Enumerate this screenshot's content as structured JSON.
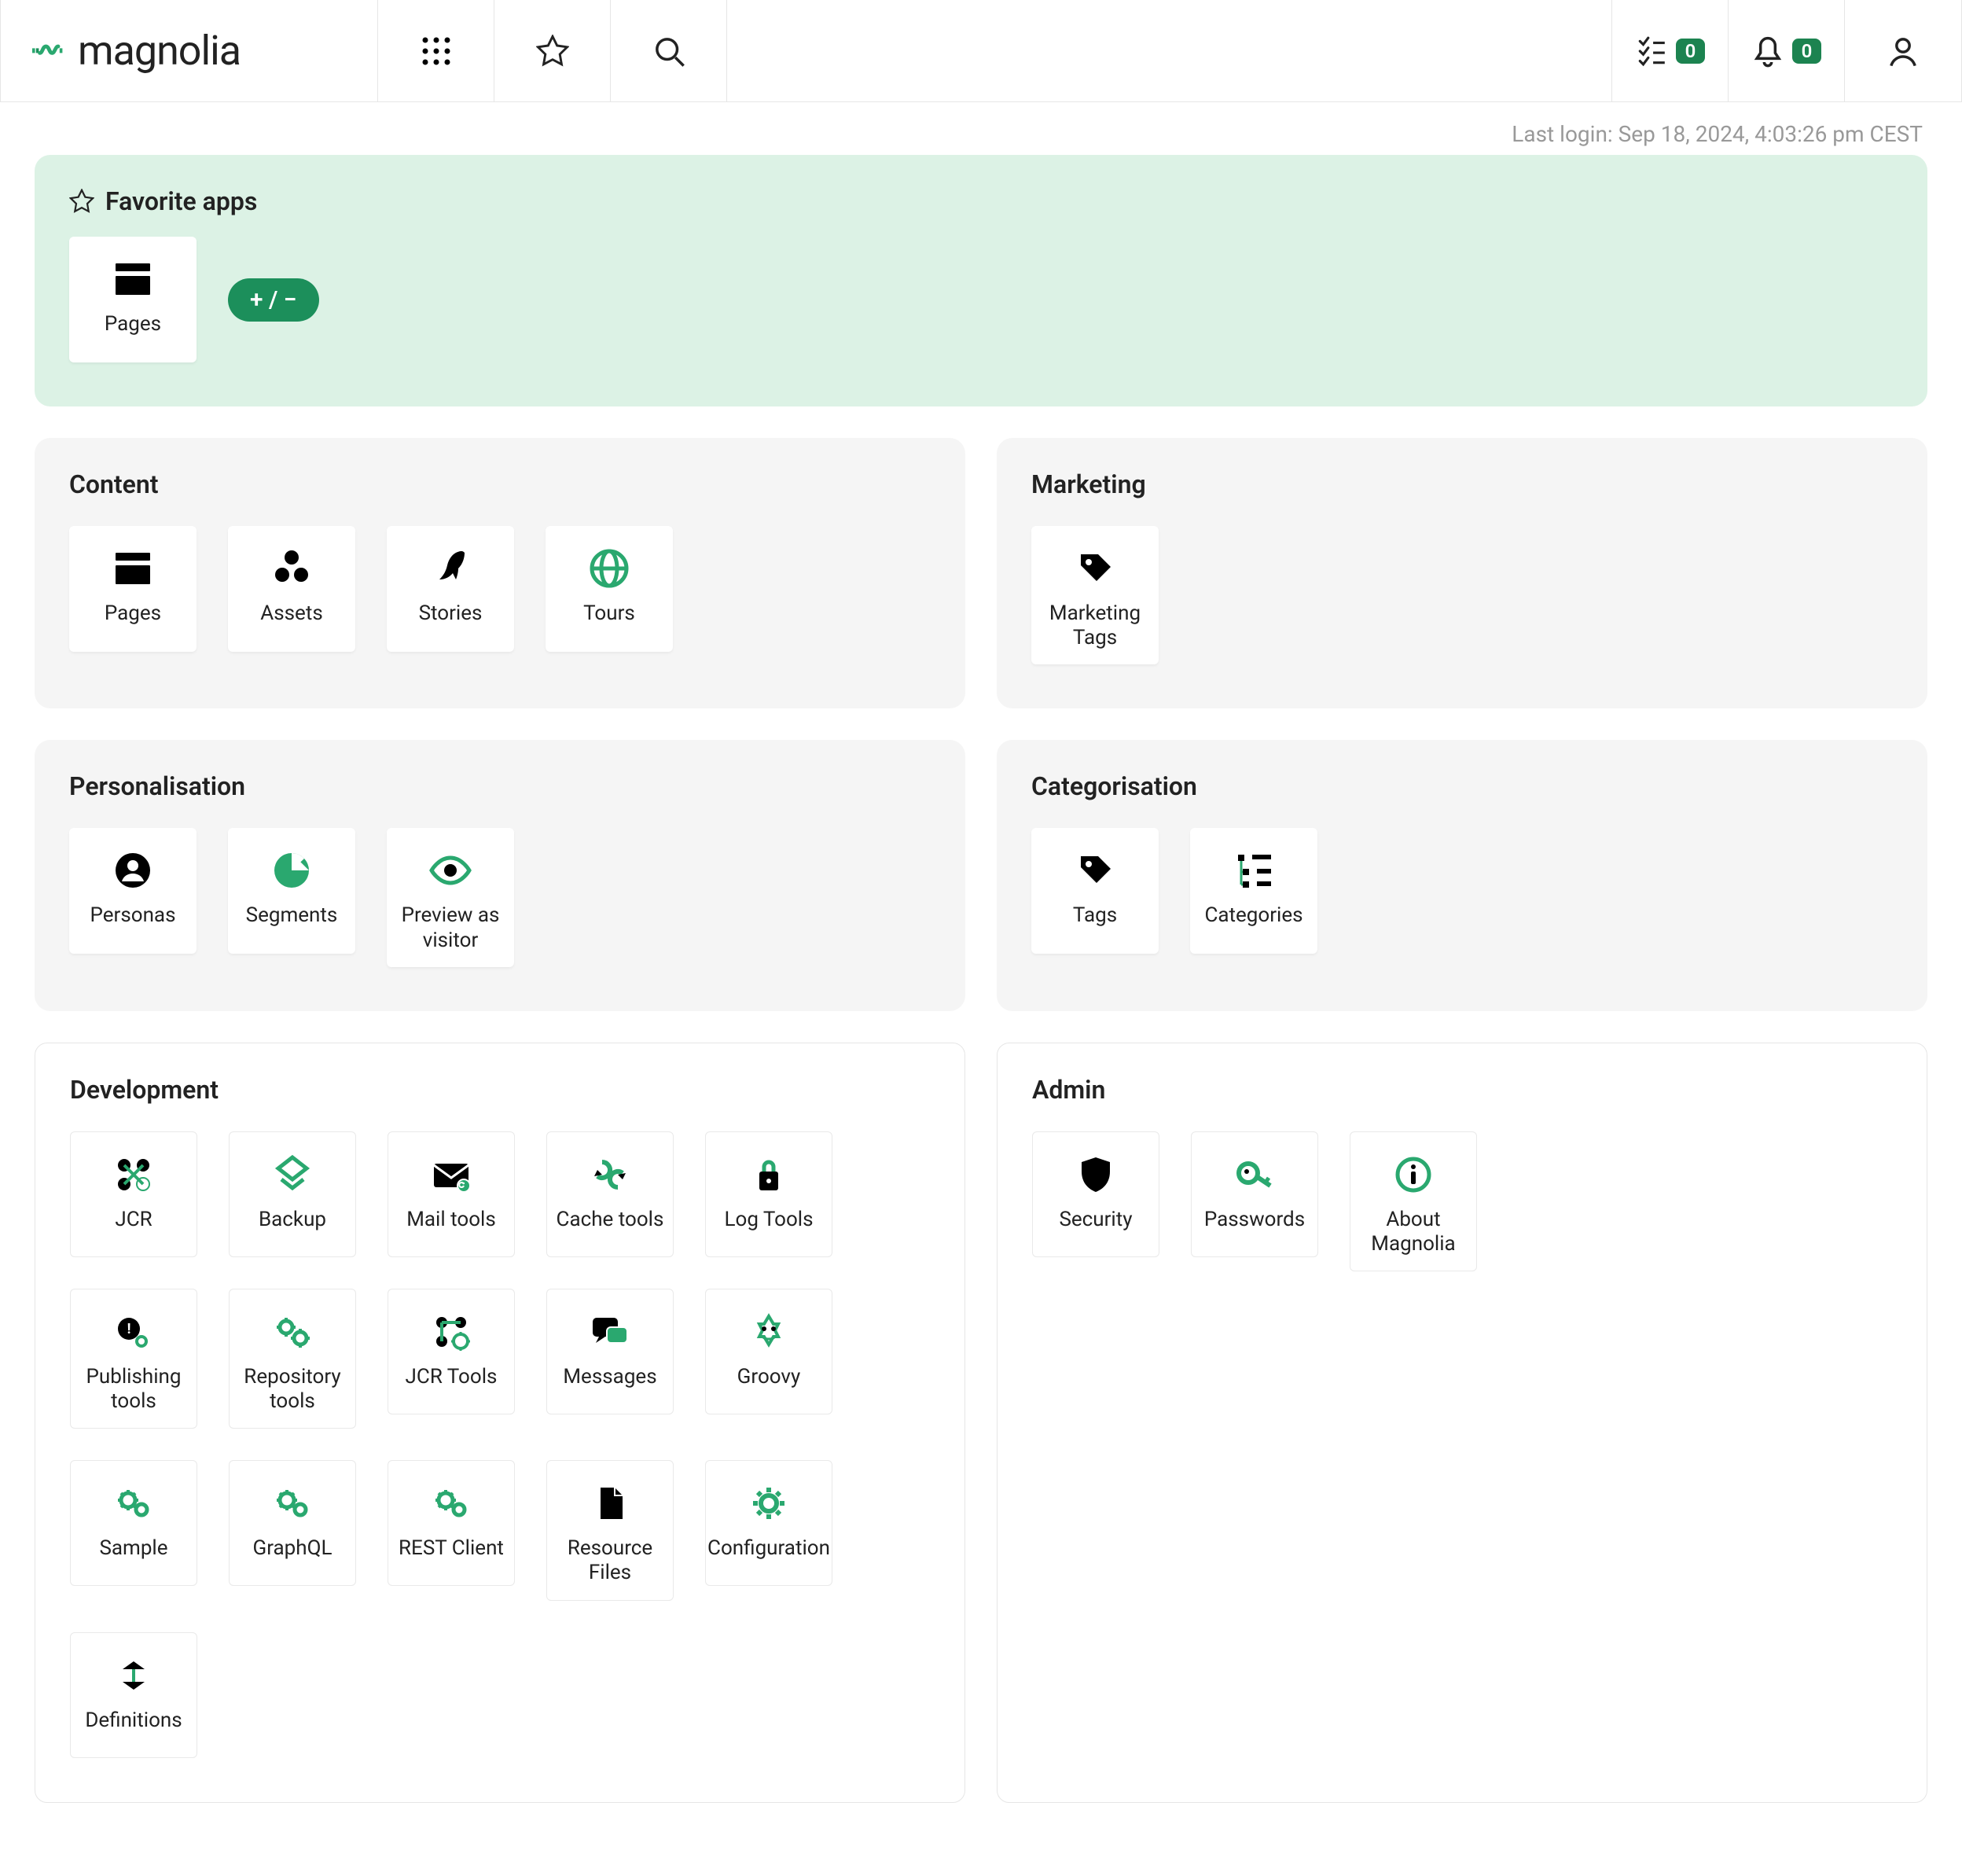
{
  "header": {
    "logo_text": "magnolia",
    "tasks_badge": "0",
    "notifications_badge": "0"
  },
  "last_login": "Last login: Sep 18, 2024, 4:03:26 pm CEST",
  "favorites": {
    "title": "Favorite apps",
    "edit_label": "+ / −",
    "items": [
      {
        "label": "Pages",
        "icon": "pages"
      }
    ]
  },
  "sections_grey": [
    {
      "title": "Content",
      "items": [
        {
          "label": "Pages",
          "icon": "pages"
        },
        {
          "label": "Assets",
          "icon": "assets"
        },
        {
          "label": "Stories",
          "icon": "stories"
        },
        {
          "label": "Tours",
          "icon": "tours"
        }
      ]
    },
    {
      "title": "Marketing",
      "items": [
        {
          "label": "Marketing Tags",
          "icon": "tag"
        }
      ]
    },
    {
      "title": "Personalisation",
      "items": [
        {
          "label": "Personas",
          "icon": "persona"
        },
        {
          "label": "Segments",
          "icon": "segments"
        },
        {
          "label": "Preview as visitor",
          "icon": "eye"
        }
      ]
    },
    {
      "title": "Categorisation",
      "items": [
        {
          "label": "Tags",
          "icon": "tag"
        },
        {
          "label": "Categories",
          "icon": "categories"
        }
      ]
    }
  ],
  "sections_bordered": [
    {
      "title": "Development",
      "items": [
        {
          "label": "JCR",
          "icon": "jcr"
        },
        {
          "label": "Backup",
          "icon": "backup"
        },
        {
          "label": "Mail tools",
          "icon": "mail"
        },
        {
          "label": "Cache tools",
          "icon": "cache"
        },
        {
          "label": "Log Tools",
          "icon": "log"
        },
        {
          "label": "Publishing tools",
          "icon": "publish"
        },
        {
          "label": "Repository tools",
          "icon": "gears"
        },
        {
          "label": "JCR Tools",
          "icon": "jcr-tools"
        },
        {
          "label": "Messages",
          "icon": "messages"
        },
        {
          "label": "Groovy",
          "icon": "groovy"
        },
        {
          "label": "Sample",
          "icon": "gears2"
        },
        {
          "label": "GraphQL",
          "icon": "gears2"
        },
        {
          "label": "REST Client",
          "icon": "gears2"
        },
        {
          "label": "Resource Files",
          "icon": "file"
        },
        {
          "label": "Configuration",
          "icon": "gear"
        },
        {
          "label": "Definitions",
          "icon": "definitions"
        }
      ]
    },
    {
      "title": "Admin",
      "items": [
        {
          "label": "Security",
          "icon": "shield"
        },
        {
          "label": "Passwords",
          "icon": "key"
        },
        {
          "label": "About Magnolia",
          "icon": "info"
        }
      ]
    }
  ]
}
